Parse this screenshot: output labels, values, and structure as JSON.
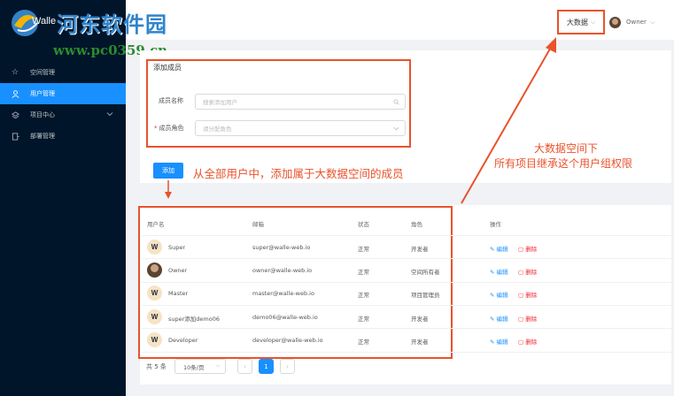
{
  "sidebar": {
    "brand": "Walle",
    "items": [
      {
        "label": "空间管理",
        "icon": "star-icon"
      },
      {
        "label": "用户管理",
        "icon": "user-icon",
        "active": true
      },
      {
        "label": "项目中心",
        "icon": "layers-icon"
      },
      {
        "label": "部署管理",
        "icon": "deploy-icon"
      }
    ]
  },
  "watermark": {
    "line1": "河东软件园",
    "line2": "www.pc0359.cn"
  },
  "header": {
    "space": "大数据",
    "user": "Owner"
  },
  "form": {
    "title": "添加成员",
    "name_label": "成员名称",
    "name_placeholder": "搜索添加用户",
    "role_label": "成员角色",
    "role_placeholder": "请分配角色",
    "add_button": "添加"
  },
  "annotations": {
    "add_note": "从全部用户中，添加属于大数据空间的成员",
    "space_note_line1": "大数据空间下",
    "space_note_line2": "所有项目继承这个用户组权限"
  },
  "table": {
    "headers": {
      "username": "用户名",
      "email": "邮箱",
      "status": "状态",
      "role": "角色",
      "actions": "操作"
    },
    "rows": [
      {
        "name": "Super",
        "email": "super@walle-web.io",
        "status": "正常",
        "role": "开发者",
        "avatar": "W"
      },
      {
        "name": "Owner",
        "email": "owner@walle-web.io",
        "status": "正常",
        "role": "空间所有者",
        "avatar": ""
      },
      {
        "name": "Master",
        "email": "master@walle-web.io",
        "status": "正常",
        "role": "项目管理员",
        "avatar": "W"
      },
      {
        "name": "super添加demo06",
        "email": "demo06@walle-web.io",
        "status": "正常",
        "role": "开发者",
        "avatar": "W"
      },
      {
        "name": "Developer",
        "email": "developer@walle-web.io",
        "status": "正常",
        "role": "开发者",
        "avatar": "W"
      }
    ],
    "edit_label": "编辑",
    "delete_label": "删除"
  },
  "pagination": {
    "total": "共 5 条",
    "page_size": "10条/页",
    "prev": "‹",
    "current": "1",
    "next": "›"
  },
  "colors": {
    "sidebar": "#001529",
    "primary": "#1890ff",
    "annotation": "#e8532c",
    "danger": "#f5222d"
  }
}
